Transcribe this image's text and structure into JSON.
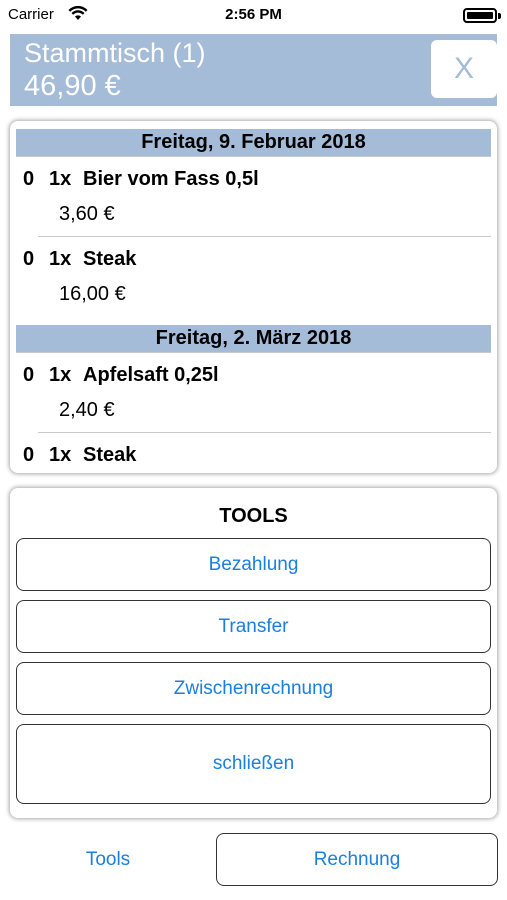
{
  "status_bar": {
    "carrier": "Carrier",
    "time": "2:56 PM",
    "battery_level": 1.0
  },
  "header": {
    "title": "Stammtisch (1)",
    "total": "46,90 €",
    "close_label": "X",
    "background_color": "#a4bcd8"
  },
  "orders": {
    "groups": [
      {
        "date": "Freitag, 9. Februar 2018",
        "items": [
          {
            "status": "0",
            "qty": "1x",
            "name": "Bier vom Fass 0,5l",
            "price": "3,60 €"
          },
          {
            "status": "0",
            "qty": "1x",
            "name": "Steak",
            "price": "16,00 €"
          }
        ]
      },
      {
        "date": "Freitag, 2. März 2018",
        "items": [
          {
            "status": "0",
            "qty": "1x",
            "name": "Apfelsaft 0,25l",
            "price": "2,40 €"
          },
          {
            "status": "0",
            "qty": "1x",
            "name": "Steak",
            "price": ""
          }
        ]
      }
    ]
  },
  "tools": {
    "title": "TOOLS",
    "buttons": {
      "bezahlung": "Bezahlung",
      "transfer": "Transfer",
      "zwischenrechnung": "Zwischenrechnung",
      "schliessen": "schließen"
    }
  },
  "bottom_bar": {
    "tools_label": "Tools",
    "rechnung_label": "Rechnung"
  },
  "colors": {
    "accent": "#1a7fe0",
    "header_bg": "#a4bcd8"
  }
}
